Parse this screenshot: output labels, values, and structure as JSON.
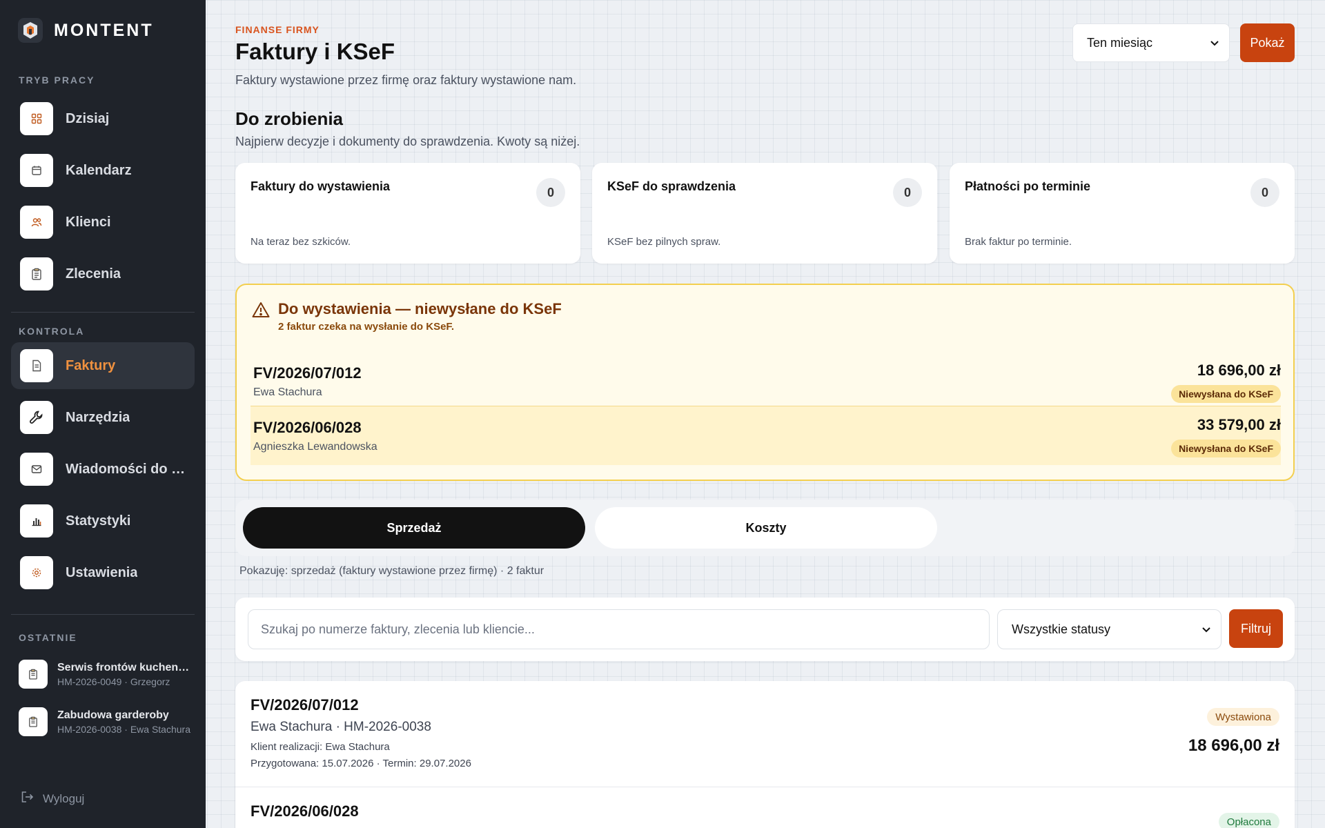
{
  "brand": {
    "name": "MONTENT"
  },
  "sidebar": {
    "section_work": "TRYB PRACY",
    "section_control": "KONTROLA",
    "section_recent": "OSTATNIE",
    "items": [
      {
        "label": "Dzisiaj",
        "icon": "grid-icon"
      },
      {
        "label": "Kalendarz",
        "icon": "calendar-icon"
      },
      {
        "label": "Klienci",
        "icon": "users-icon"
      },
      {
        "label": "Zlecenia",
        "icon": "clipboard-icon"
      },
      {
        "label": "Faktury",
        "icon": "document-icon",
        "active": true
      },
      {
        "label": "Narzędzia",
        "icon": "wrench-icon"
      },
      {
        "label": "Wiadomości do klientów",
        "icon": "mail-icon"
      },
      {
        "label": "Statystyki",
        "icon": "bar-chart-icon"
      },
      {
        "label": "Ustawienia",
        "icon": "gear-icon"
      }
    ],
    "recent": [
      {
        "title": "Serwis frontów kuchennych",
        "sub": "HM-2026-0049 · Grzegorz"
      },
      {
        "title": "Zabudowa garderoby",
        "sub": "HM-2026-0038 · Ewa Stachura"
      }
    ],
    "logout": "Wyloguj"
  },
  "header": {
    "eyebrow": "FINANSE FIRMY",
    "title": "Faktury i KSeF",
    "subtitle": "Faktury wystawione przez firmę oraz faktury wystawione nam.",
    "period_value": "Ten miesiąc",
    "show_button": "Pokaż"
  },
  "todo": {
    "title": "Do zrobienia",
    "subtitle": "Najpierw decyzje i dokumenty do sprawdzenia. Kwoty są niżej.",
    "cards": [
      {
        "title": "Faktury do wystawienia",
        "count": "0",
        "note": "Na teraz bez szkiców."
      },
      {
        "title": "KSeF do sprawdzenia",
        "count": "0",
        "note": "KSeF bez pilnych spraw."
      },
      {
        "title": "Płatności po terminie",
        "count": "0",
        "note": "Brak faktur po terminie."
      }
    ]
  },
  "alert": {
    "title": "Do wystawienia — niewysłane do KSeF",
    "subtitle": "2 faktur czeka na wysłanie do KSeF.",
    "rows": [
      {
        "number": "FV/2026/07/012",
        "client": "Ewa Stachura",
        "amount": "18 696,00 zł",
        "badge": "Niewysłana do KSeF"
      },
      {
        "number": "FV/2026/06/028",
        "client": "Agnieszka Lewandowska",
        "amount": "33 579,00 zł",
        "badge": "Niewysłana do KSeF"
      }
    ]
  },
  "tabs": {
    "sales": "Sprzedaż",
    "costs": "Koszty"
  },
  "showing": "Pokazuję: sprzedaż (faktury wystawione przez firmę) · 2 faktur",
  "filters": {
    "search_placeholder": "Szukaj po numerze faktury, zlecenia lub kliencie...",
    "status_value": "Wszystkie statusy",
    "filter_button": "Filtruj"
  },
  "invoices": [
    {
      "number": "FV/2026/07/012",
      "client_line": "Ewa Stachura · HM-2026-0038",
      "realization": "Klient realizacji: Ewa Stachura",
      "dates": "Przygotowana: 15.07.2026 · Termin: 29.07.2026",
      "status": "Wystawiona",
      "amount": "18 696,00 zł"
    },
    {
      "number": "FV/2026/06/028",
      "status": "Opłacona"
    }
  ],
  "colors": {
    "accent": "#c8430f",
    "sidebar_bg": "#1f232a",
    "active_nav_text": "#f0913f",
    "alert_border": "#f3cf4f",
    "badge_issued_bg": "#fdf1dc",
    "badge_paid_bg": "#e3f4e8"
  }
}
